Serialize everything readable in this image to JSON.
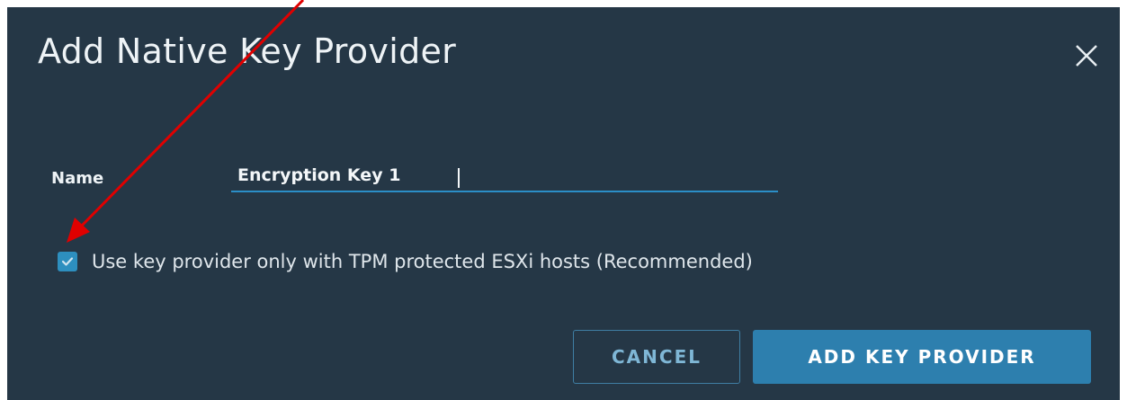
{
  "dialog": {
    "title": "Add Native Key Provider",
    "close_icon": "close-icon"
  },
  "form": {
    "name_label": "Name",
    "name_value": "Encryption Key 1",
    "tpm_checkbox": {
      "checked": true,
      "label": "Use key provider only with TPM protected ESXi hosts (Recommended)"
    }
  },
  "footer": {
    "cancel_label": "CANCEL",
    "add_label": "ADD KEY PROVIDER"
  },
  "annotation": {
    "icon": "red-arrow-icon",
    "color": "#e00000"
  },
  "colors": {
    "dialog_bg": "#253746",
    "accent": "#2d8fbf",
    "primary_button": "#2d7fae"
  }
}
